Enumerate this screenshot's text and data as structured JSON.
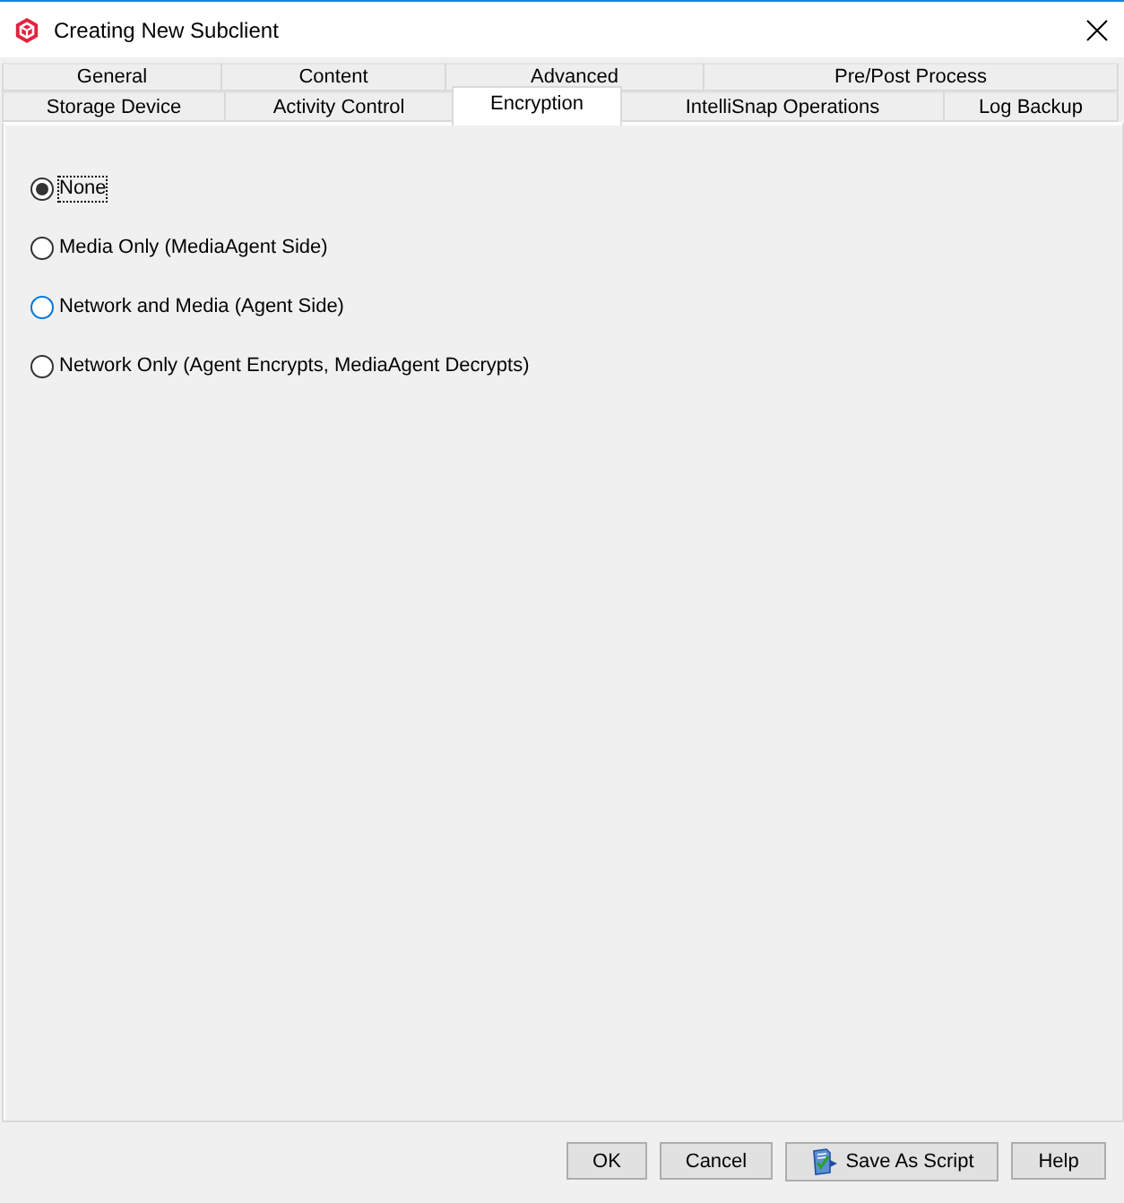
{
  "window": {
    "title": "Creating New Subclient"
  },
  "tab_rows": [
    {
      "tabs": [
        {
          "label": "General",
          "selected": false
        },
        {
          "label": "Content",
          "selected": false
        },
        {
          "label": "Advanced",
          "selected": false
        },
        {
          "label": "Pre/Post Process",
          "selected": false
        }
      ]
    },
    {
      "tabs": [
        {
          "label": "Storage Device",
          "selected": false
        },
        {
          "label": "Activity Control",
          "selected": false
        },
        {
          "label": "Encryption",
          "selected": true
        },
        {
          "label": "IntelliSnap Operations",
          "selected": false
        },
        {
          "label": "Log Backup",
          "selected": false
        }
      ]
    }
  ],
  "encryption_options": [
    {
      "label": "None",
      "selected": true,
      "focused": true,
      "hovered": false
    },
    {
      "label": "Media Only (MediaAgent Side)",
      "selected": false,
      "focused": false,
      "hovered": false
    },
    {
      "label": "Network and Media (Agent Side)",
      "selected": false,
      "focused": false,
      "hovered": true
    },
    {
      "label": "Network Only (Agent Encrypts, MediaAgent Decrypts)",
      "selected": false,
      "focused": false,
      "hovered": false
    }
  ],
  "buttons": [
    {
      "label": "OK",
      "kind": "text"
    },
    {
      "label": "Cancel",
      "kind": "text"
    },
    {
      "label": "Save As Script",
      "kind": "script"
    },
    {
      "label": "Help",
      "kind": "text"
    }
  ]
}
